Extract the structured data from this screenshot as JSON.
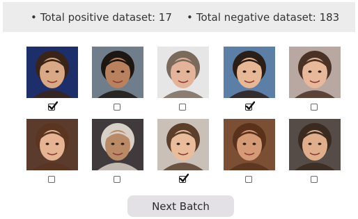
{
  "stats": {
    "bullet": "•",
    "positive_label": "Total positive dataset: 17",
    "negative_label": "Total negative dataset: 183"
  },
  "faces": [
    {
      "name": "face-1",
      "checked": true,
      "bg": "#1d2f6b",
      "skin": "#d9a884",
      "hair": "#3a2418"
    },
    {
      "name": "face-2",
      "checked": false,
      "bg": "#6f7e8a",
      "skin": "#b9825e",
      "hair": "#1d1712"
    },
    {
      "name": "face-3",
      "checked": false,
      "bg": "#e6e6e6",
      "skin": "#e3b39a",
      "hair": "#7a6a5c"
    },
    {
      "name": "face-4",
      "checked": true,
      "bg": "#5c7fa8",
      "skin": "#e6b895",
      "hair": "#2b1e17"
    },
    {
      "name": "face-5",
      "checked": false,
      "bg": "#b9a8a2",
      "skin": "#e7b99a",
      "hair": "#4a3224"
    },
    {
      "name": "face-6",
      "checked": false,
      "bg": "#5a3b2c",
      "skin": "#e6b493",
      "hair": "#5a3520"
    },
    {
      "name": "face-7",
      "checked": false,
      "bg": "#403a3c",
      "skin": "#b98a66",
      "hair": "#d8cfc7"
    },
    {
      "name": "face-8",
      "checked": true,
      "bg": "#c9c1b8",
      "skin": "#e9bd9c",
      "hair": "#5b3f2b"
    },
    {
      "name": "face-9",
      "checked": false,
      "bg": "#7a4f33",
      "skin": "#d59a76",
      "hair": "#5a321c"
    },
    {
      "name": "face-10",
      "checked": false,
      "bg": "#554c47",
      "skin": "#e1ae8c",
      "hair": "#3b2a1f"
    }
  ],
  "next_button": {
    "label": "Next Batch"
  }
}
